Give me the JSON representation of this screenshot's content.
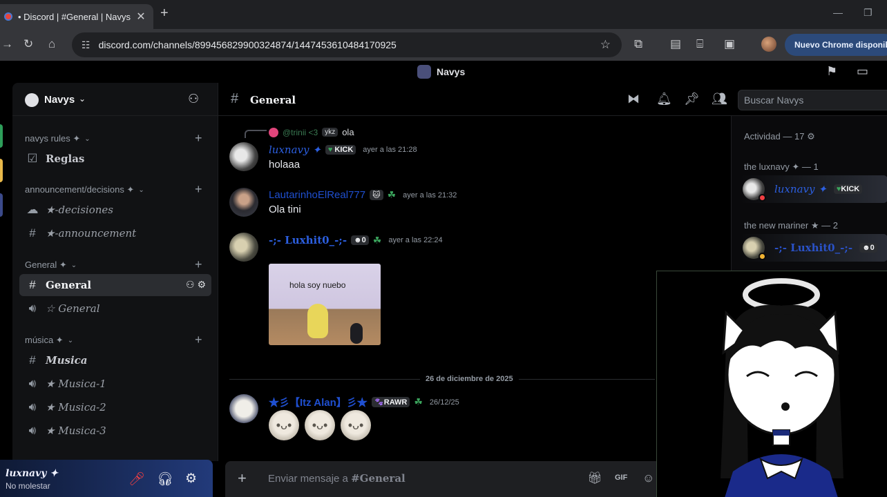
{
  "browser": {
    "tab_title": "• Discord | #General | Navys",
    "url": "discord.com/channels/899456829900324874/1447453610484170925",
    "update_label": "Nuevo Chrome disponible"
  },
  "titlebar": {
    "server_name": "Navys"
  },
  "sidebar": {
    "server_name": "Navys",
    "categories": [
      {
        "label": "navys rules ✦",
        "channels": [
          {
            "label": "Reglas"
          }
        ]
      },
      {
        "label": "announcement/decisions ✦",
        "channels": [
          {
            "label": "★-decisiones"
          },
          {
            "label": "★-announcement"
          }
        ]
      },
      {
        "label": "General ✦",
        "channels": [
          {
            "label": "General"
          },
          {
            "label": "☆ General"
          }
        ]
      },
      {
        "label": "música ✦",
        "channels": [
          {
            "label": "Musica"
          },
          {
            "label": "★ Musica-1"
          },
          {
            "label": "★ Musica-2"
          },
          {
            "label": "★ Musica-3"
          }
        ]
      }
    ]
  },
  "user_panel": {
    "name": "luxnavy ✦",
    "status": "No molestar"
  },
  "channel_header": {
    "name": "General",
    "search_placeholder": "Buscar Navys"
  },
  "messages": [
    {
      "reply": {
        "name": "@trinii <3",
        "tag": "ykz",
        "text": "ola"
      },
      "author": "luxnavy ✦",
      "tag": "KICK",
      "timestamp": "ayer a las 21:28",
      "text": "holaaa"
    },
    {
      "author": "LautarinhoElReal777",
      "timestamp": "ayer a las 21:32",
      "text": "Ola tini"
    },
    {
      "author": "-;- Luxhit0_-;-",
      "tag": "0",
      "timestamp": "ayer a las 22:24",
      "attachment_caption": "hola soy nuebo"
    },
    {
      "author": "★彡【Itz Alan】彡★",
      "tag": "RAWR",
      "timestamp": "26/12/25"
    }
  ],
  "date_divider": "26 de diciembre de 2025",
  "composer": {
    "placeholder_prefix": "Enviar mensaje a ",
    "placeholder_channel": "#General"
  },
  "members": {
    "activity_title": "Actividad — 17",
    "roles": [
      {
        "label": "the luxnavy ✦ — 1",
        "member": "luxnavy ✦",
        "tag": "KICK"
      },
      {
        "label": "the new mariner ★ — 2",
        "member": "-;- Luxhit0_-;-",
        "tag": "0"
      }
    ]
  },
  "colors": {
    "accent_blue": "#2c5fe0",
    "dnd_red": "#f23f43",
    "online_green": "#3ba55d"
  }
}
